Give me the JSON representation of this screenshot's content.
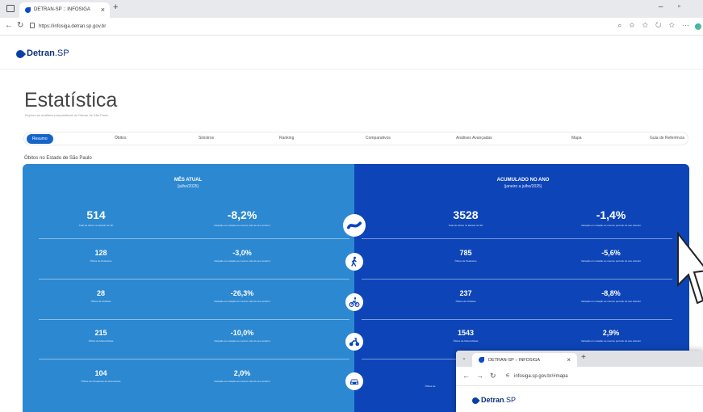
{
  "browser": {
    "tab_title": "DETRAN-SP :: INFOSIGA",
    "tab_close": "×",
    "new_tab": "+",
    "url": "https://infosiga.detran.sp.gov.br"
  },
  "site": {
    "logo_text": "Detran",
    "logo_suffix": ".SP"
  },
  "page": {
    "title": "Estatística",
    "subtitle": "Explore as análises comparativas do Detran de São Paulo",
    "tabs": [
      "Resumo",
      "Óbitos",
      "Sinistros",
      "Ranking",
      "Comparativos",
      "Análises Avançadas",
      "Mapa",
      "Guia de Referência"
    ],
    "section_label": "Óbitos no Estado de São Paulo"
  },
  "dashboard": {
    "left_header": {
      "title": "MÊS ATUAL",
      "period": "(julho/2025)"
    },
    "right_header": {
      "title": "ACUMULADO NO ANO",
      "period": "(janeiro a julho/2025)"
    },
    "rows": [
      {
        "icon": "road-icon",
        "month_value": "514",
        "month_caption": "Total de óbitos no Estado de SP",
        "month_change": "-8,2%",
        "month_change_caption": "Variação em relação ao mesmo mês do ano anterior",
        "year_value": "3528",
        "year_caption": "Total de óbitos no Estado de SP",
        "year_change": "-1,4%",
        "year_change_caption": "Variação em relação ao mesmo período do ano anterior"
      },
      {
        "icon": "pedestrian-icon",
        "month_value": "128",
        "month_caption": "Óbitos de Pedestres",
        "month_change": "-3,0%",
        "month_change_caption": "Variação em relação ao mesmo mês do ano anterior",
        "year_value": "785",
        "year_caption": "Óbitos de Pedestres",
        "year_change": "-5,6%",
        "year_change_caption": "Variação em relação ao mesmo período do ano anterior"
      },
      {
        "icon": "bicycle-icon",
        "month_value": "28",
        "month_caption": "Óbitos de Ciclistas",
        "month_change": "-26,3%",
        "month_change_caption": "Variação em relação ao mesmo mês do ano anterior",
        "year_value": "237",
        "year_caption": "Óbitos de Ciclistas",
        "year_change": "-8,8%",
        "year_change_caption": "Variação em relação ao mesmo período do ano anterior"
      },
      {
        "icon": "motorcycle-icon",
        "month_value": "215",
        "month_caption": "Óbitos de Motociclistas",
        "month_change": "-10,0%",
        "month_change_caption": "Variação em relação ao mesmo mês do ano anterior",
        "year_value": "1543",
        "year_caption": "Óbitos de Motociclistas",
        "year_change": "2,9%",
        "year_change_caption": "Variação em relação ao mesmo período do ano anterior"
      },
      {
        "icon": "car-icon",
        "month_value": "104",
        "month_caption": "Óbitos de Ocupantes de Automóveis",
        "month_change": "2,0%",
        "month_change_caption": "Variação em relação ao mesmo mês do ano anterior",
        "year_value": "",
        "year_caption": "Óbitos de",
        "year_change": "",
        "year_change_caption": ""
      }
    ]
  },
  "popup": {
    "tab_title": "DETRAN-SP :: INFOSIGA",
    "tab_close": "×",
    "new_tab": "+",
    "url": "infosiga.sp.gov.br/#mapa",
    "logo_text": "Detran",
    "logo_suffix": ".SP"
  },
  "colors": {
    "left_panel": "#2c88d1",
    "right_panel": "#0d45b8",
    "accent": "#1565c9"
  }
}
